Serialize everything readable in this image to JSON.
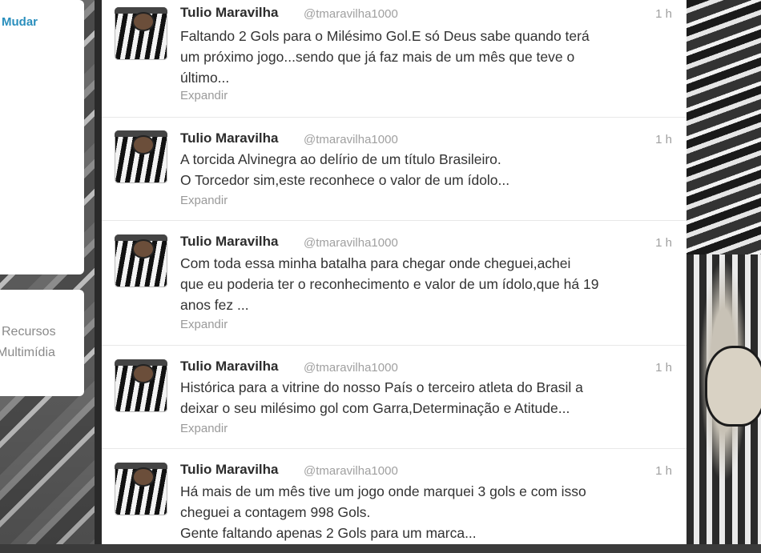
{
  "left_panel": {
    "change_link": "Mudar",
    "resources_line1": "Recursos",
    "resources_line2": "Multimídia"
  },
  "tweets": [
    {
      "name": "Tulio Maravilha",
      "handle": "@tmaravilha1000",
      "time": "1 h",
      "text": "Faltando 2 Gols para o Milésimo Gol.E só Deus sabe quando terá\num próximo jogo...sendo que já faz mais de um mês que teve o\núltimo...",
      "expand": "Expandir"
    },
    {
      "name": "Tulio Maravilha",
      "handle": "@tmaravilha1000",
      "time": "1 h",
      "text": "A torcida Alvinegra ao delírio de um título Brasileiro.\nO Torcedor sim,este reconhece o valor de um ídolo...",
      "expand": "Expandir"
    },
    {
      "name": "Tulio Maravilha",
      "handle": "@tmaravilha1000",
      "time": "1 h",
      "text": "Com toda essa minha batalha para chegar onde cheguei,achei\nque eu poderia ter o reconhecimento e valor de um ídolo,que há 19\nanos fez ...",
      "expand": "Expandir"
    },
    {
      "name": "Tulio Maravilha",
      "handle": "@tmaravilha1000",
      "time": "1 h",
      "text": "Histórica para a vitrine do nosso País o terceiro atleta do Brasil a\ndeixar o seu milésimo gol com Garra,Determinação e Atitude...",
      "expand": "Expandir"
    },
    {
      "name": "Tulio Maravilha",
      "handle": "@tmaravilha1000",
      "time": "1 h",
      "text": "Há mais de um mês tive um jogo onde marquei 3 gols e com isso\ncheguei a contagem 998 Gols.\nGente faltando apenas 2 Gols para um marca...",
      "expand": ""
    }
  ]
}
